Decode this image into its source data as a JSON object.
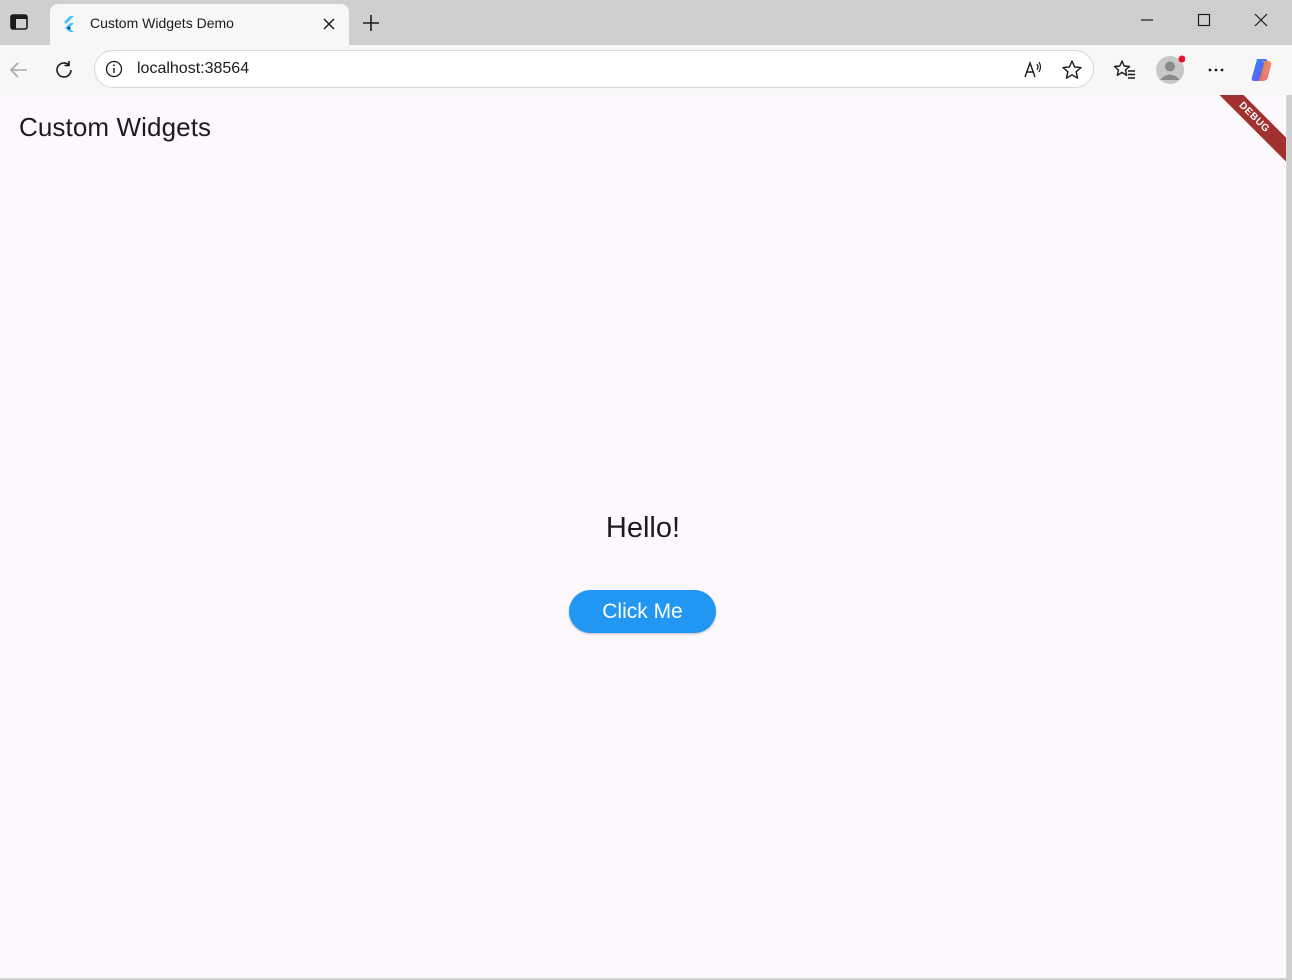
{
  "browser": {
    "tab": {
      "title": "Custom Widgets Demo"
    },
    "address": {
      "url": "localhost:38564"
    },
    "accent_profile_dot": "#e81123"
  },
  "app": {
    "title": "Custom Widgets",
    "greeting": "Hello!",
    "button_label": "Click Me",
    "debug_banner": "DEBUG",
    "colors": {
      "background": "#fdf7fe",
      "button": "#2196f3",
      "banner": "#a0312e"
    }
  },
  "icons": {
    "tab_actions": "tab-actions-icon",
    "favicon": "flutter-logo-icon",
    "tab_close": "close-icon",
    "new_tab": "plus-icon",
    "minimize": "minimize-icon",
    "maximize": "maximize-icon",
    "close_window": "close-icon",
    "back": "back-arrow-icon",
    "refresh": "refresh-icon",
    "site_info": "info-icon",
    "read_aloud": "read-aloud-icon",
    "favorite": "star-icon",
    "favorites": "favorites-icon",
    "profile": "profile-icon",
    "more": "more-icon",
    "copilot": "copilot-icon"
  }
}
